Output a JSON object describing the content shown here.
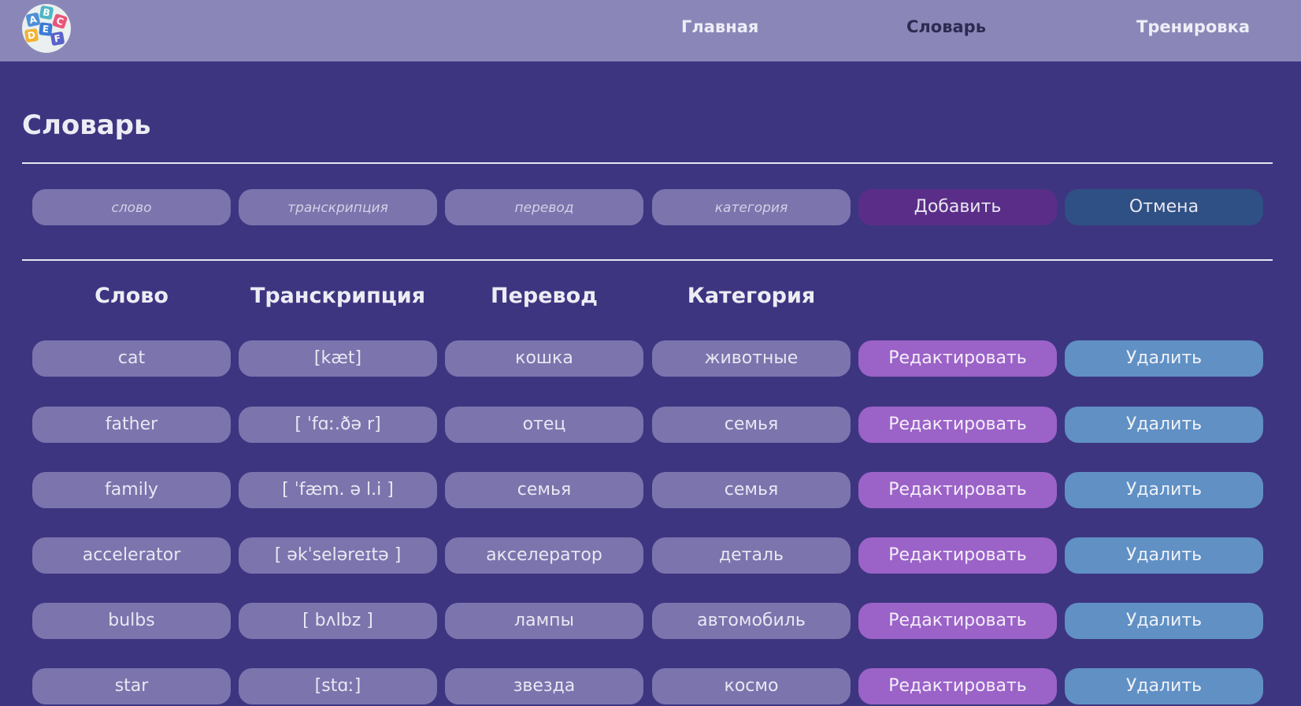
{
  "logo": {
    "letters": [
      "A",
      "B",
      "C",
      "D",
      "E",
      "F"
    ],
    "colors": [
      "#4e8fd6",
      "#4fb6c4",
      "#e9557a",
      "#f2b233",
      "#3c7bd4",
      "#5a63c9"
    ]
  },
  "nav": {
    "items": [
      {
        "label": "Главная",
        "active": false
      },
      {
        "label": "Словарь",
        "active": true
      },
      {
        "label": "Тренировка",
        "active": false
      }
    ]
  },
  "page": {
    "title": "Словарь"
  },
  "form": {
    "word_placeholder": "слово",
    "transcription_placeholder": "транскрипция",
    "translation_placeholder": "перевод",
    "category_placeholder": "категория",
    "add_label": "Добавить",
    "cancel_label": "Отмена"
  },
  "table": {
    "headers": [
      "Слово",
      "Транскрипция",
      "Перевод",
      "Категория"
    ],
    "rows": [
      {
        "word": "cat",
        "transcription": "[kæt]",
        "translation": "кошка",
        "category": "животные",
        "edit": "Редактировать",
        "delete": "Удалить"
      },
      {
        "word": "father",
        "transcription": "[ ˈfɑː.ðə r]",
        "translation": "отец",
        "category": "семья",
        "edit": "Редактировать",
        "delete": "Удалить"
      },
      {
        "word": "family",
        "transcription": "[ ˈfæm. ə l.i ]",
        "translation": "семья",
        "category": "семья",
        "edit": "Редактировать",
        "delete": "Удалить"
      },
      {
        "word": "accelerator",
        "transcription": "[ əkˈseləreɪtə ]",
        "translation": "акселератор",
        "category": "деталь",
        "edit": "Редактировать",
        "delete": "Удалить"
      },
      {
        "word": "bulbs",
        "transcription": "[ bʌlbz ]",
        "translation": "лампы",
        "category": "автомобиль",
        "edit": "Редактировать",
        "delete": "Удалить"
      },
      {
        "word": "star",
        "transcription": "[stɑː]",
        "translation": "звезда",
        "category": "космо",
        "edit": "Редактировать",
        "delete": "Удалить"
      }
    ]
  },
  "colors": {
    "background": "#3d3580",
    "topbar": "#8a87b8",
    "cell": "#7c74ad",
    "add_button": "#5a2e88",
    "cancel_button": "#2f5084",
    "edit_button": "#9b62c8",
    "delete_button": "#6090c4"
  }
}
